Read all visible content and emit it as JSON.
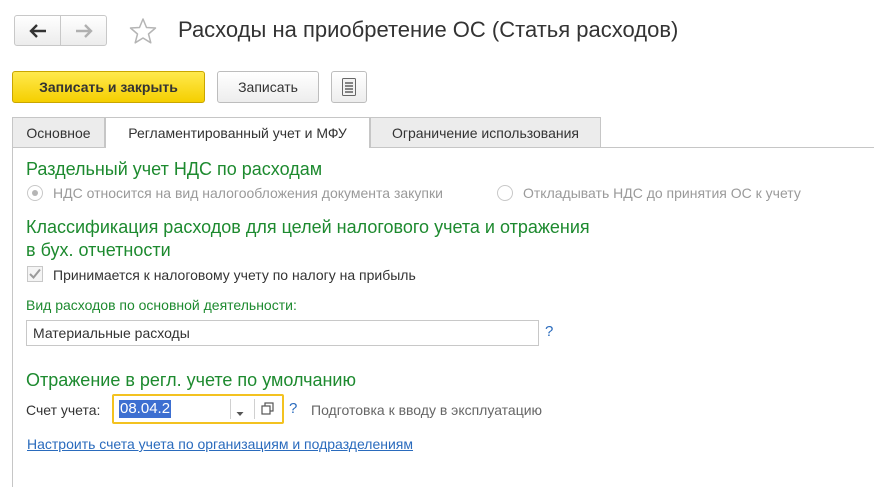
{
  "header": {
    "title": "Расходы на приобретение ОС (Статья расходов)"
  },
  "toolbar": {
    "save_close_label": "Записать и закрыть",
    "save_label": "Записать"
  },
  "tabs": [
    {
      "label": "Основное",
      "active": false
    },
    {
      "label": "Регламентированный учет и МФУ",
      "active": true
    },
    {
      "label": "Ограничение использования",
      "active": false
    }
  ],
  "vat_section": {
    "heading": "Раздельный учет НДС по расходам",
    "option1": "НДС относится на вид налогообложения документа закупки",
    "option2": "Откладывать НДС до принятия ОС к учету",
    "selected": "option1"
  },
  "classification": {
    "heading_line1": "Классификация расходов для целей налогового учета и отражения",
    "heading_line2": "в бух. отчетности",
    "checkbox_label": "Принимается к налоговому учету по налогу на прибыль",
    "checkbox_checked": true,
    "expense_type_label": "Вид расходов по основной деятельности:",
    "expense_type_value": "Материальные расходы",
    "help": "?"
  },
  "reflection": {
    "heading": "Отражение в регл. учете по умолчанию",
    "account_label": "Счет учета:",
    "account_value": "08.04.2",
    "help": "?",
    "account_description": "Подготовка к вводу в эксплуатацию",
    "setup_link": "Настроить счета учета по организациям и подразделениям"
  },
  "colors": {
    "accent_green": "#1d8a2f",
    "primary_button": "#f5cf00",
    "link": "#2a6bbd",
    "focus_border": "#f3c220"
  }
}
